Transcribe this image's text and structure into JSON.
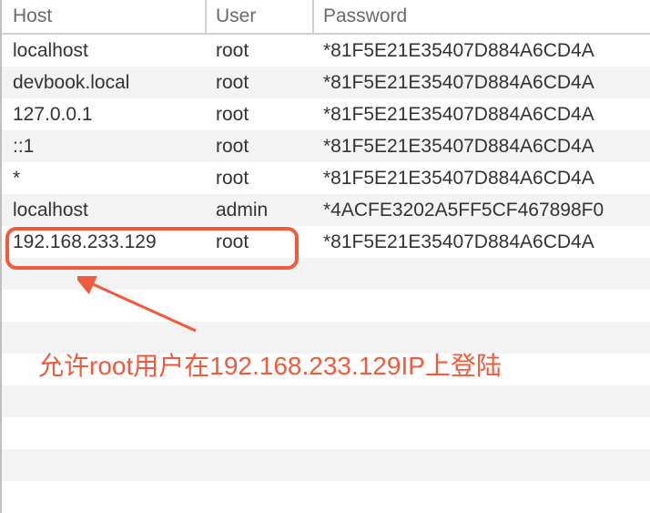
{
  "table": {
    "headers": {
      "host": "Host",
      "user": "User",
      "password": "Password"
    },
    "rows": [
      {
        "host": "localhost",
        "user": "root",
        "password": "*81F5E21E35407D884A6CD4A"
      },
      {
        "host": "devbook.local",
        "user": "root",
        "password": "*81F5E21E35407D884A6CD4A"
      },
      {
        "host": "127.0.0.1",
        "user": "root",
        "password": "*81F5E21E35407D884A6CD4A"
      },
      {
        "host": "::1",
        "user": "root",
        "password": "*81F5E21E35407D884A6CD4A"
      },
      {
        "host": "*",
        "user": "root",
        "password": "*81F5E21E35407D884A6CD4A"
      },
      {
        "host": "localhost",
        "user": "admin",
        "password": "*4ACFE3202A5FF5CF467898F0"
      },
      {
        "host": "192.168.233.129",
        "user": "root",
        "password": "*81F5E21E35407D884A6CD4A"
      }
    ]
  },
  "annotation": {
    "text": "允许root用户在192.168.233.129IP上登陆"
  },
  "colors": {
    "highlight": "#f15a3a",
    "header_text": "#6a6a6a",
    "border": "#d0d0d0",
    "row_odd": "#f3f3f3"
  }
}
